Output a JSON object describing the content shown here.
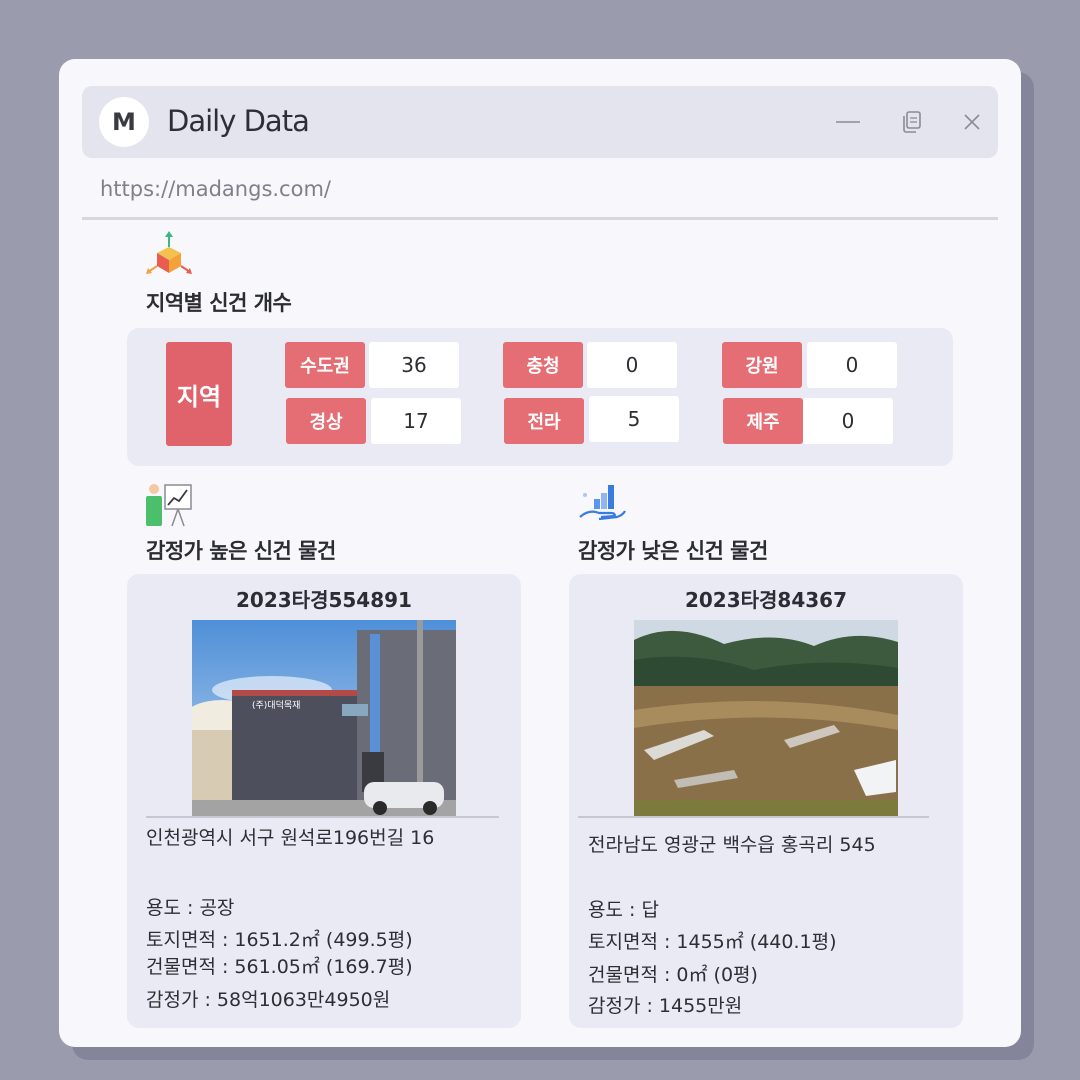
{
  "window": {
    "avatar_letter": "M",
    "title": "Daily Data",
    "url": "https://madangs.com/"
  },
  "region_section": {
    "title": "지역별 신건 개수",
    "icon": "3d-axes-icon",
    "tag": "지역",
    "items": [
      {
        "label": "수도권",
        "value": "36"
      },
      {
        "label": "충청",
        "value": "0"
      },
      {
        "label": "강원",
        "value": "0"
      },
      {
        "label": "경상",
        "value": "17"
      },
      {
        "label": "전라",
        "value": "5"
      },
      {
        "label": "제주",
        "value": "0"
      }
    ]
  },
  "high_section": {
    "title": "감정가 높은 신건 물건",
    "icon": "presentation-chart-icon",
    "case_no": "2023타경554891",
    "address": "인천광역시 서구 원석로196번길 16",
    "usage": "용도 : 공장",
    "land_area": "토지면적 : 1651.2㎡ (499.5평)",
    "building_area": "건물면적 : 561.05㎡ (169.7평)",
    "appraisal": "감정가 : 58억1063만4950원",
    "sign_text": "(주)대덕목재"
  },
  "low_section": {
    "title": "감정가 낮은 신건 물건",
    "icon": "hand-chart-icon",
    "case_no": "2023타경84367",
    "address": "전라남도 영광군 백수읍 홍곡리 545",
    "usage": "용도 :  답",
    "land_area": "토지면적 : 1455㎡ (440.1평)",
    "building_area": "건물면적 : 0㎡ (0평)",
    "appraisal": "감정가 : 1455만원"
  },
  "colors": {
    "label_red": "#e56d74",
    "tag_red": "#e0636c",
    "panel": "#e9eaf4",
    "window_bg": "#f7f7fc",
    "backdrop": "#9a9bac"
  }
}
